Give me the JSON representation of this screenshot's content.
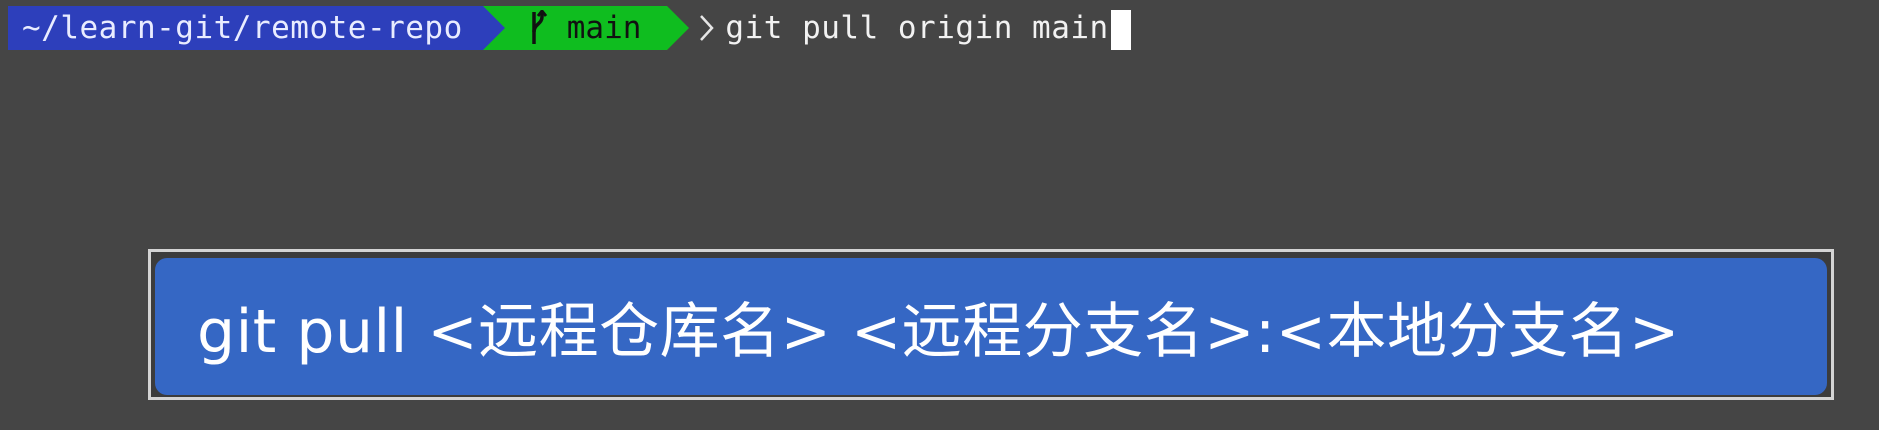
{
  "terminal": {
    "prompt": {
      "path": "~/learn-git/remote-repo",
      "branch_icon": "git-branch-icon",
      "branch": "main",
      "prompt_symbol_icon": "chevron-right-icon"
    },
    "command": "git pull origin main"
  },
  "caption": {
    "text": "git pull <远程仓库名> <远程分支名>:<本地分支名>"
  },
  "colors": {
    "background": "#454545",
    "path_segment": "#2d3fbb",
    "branch_segment": "#0fbd1f",
    "caption_box": "#3567c4",
    "caption_frame": "#d4d4d4"
  }
}
